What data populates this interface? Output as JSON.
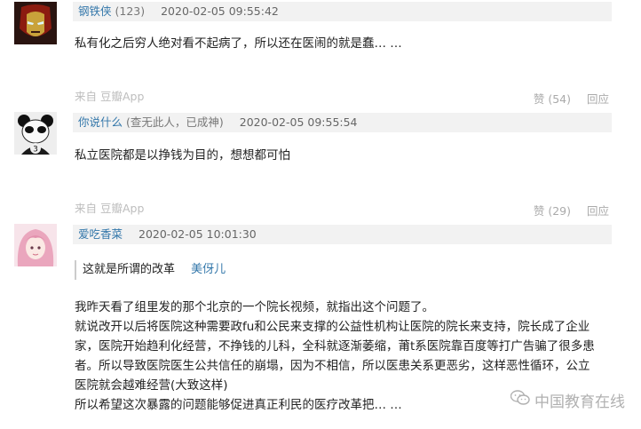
{
  "comments": [
    {
      "author": "钢铁侠",
      "author_sub": "(123)",
      "time": "2020-02-05 09:55:42",
      "text": "私有化之后穷人绝对看不起病了，所以还在医闹的就是蠢… …",
      "source": "来自 豆瓣App",
      "likes": "赞 (54)",
      "reply": "回应"
    },
    {
      "author": "你说什么",
      "author_sub": "(查无此人，已成神)",
      "time": "2020-02-05 09:55:54",
      "text": "私立医院都是以挣钱为目的，想想都可怕",
      "source": "来自 豆瓣App",
      "likes": "赞 (29)",
      "reply": "回应"
    },
    {
      "author": "爱吃香菜",
      "time": "2020-02-05 10:01:30",
      "quote_text": "这就是所谓的改革",
      "quote_author": "美伢儿",
      "lines": [
        "我昨天看了组里发的那个北京的一个院长视频，就指出这个问题了。",
        "就说改开以后将医院这种需要政fu和公民来支撑的公益性机构让医院的院长来支持，院长成了企业",
        "家，医院开始趋利化经营，不挣钱的儿科，全科就逐渐萎缩，莆t系医院靠百度等打广告骗了很多患",
        "者。所以导致医院医生公共信任的崩塌，因为不相信，所以医患关系更恶劣，这样恶性循环，公立",
        "医院就会越难经营(大致这样)",
        "所以希望这次暴露的问题能够促进真正利民的医疗改革把… …"
      ]
    }
  ],
  "watermark": "中国教育在线",
  "colors": {
    "link": "#3377aa",
    "meta_bg": "#f2f2f2",
    "muted": "#aaaaaa"
  }
}
